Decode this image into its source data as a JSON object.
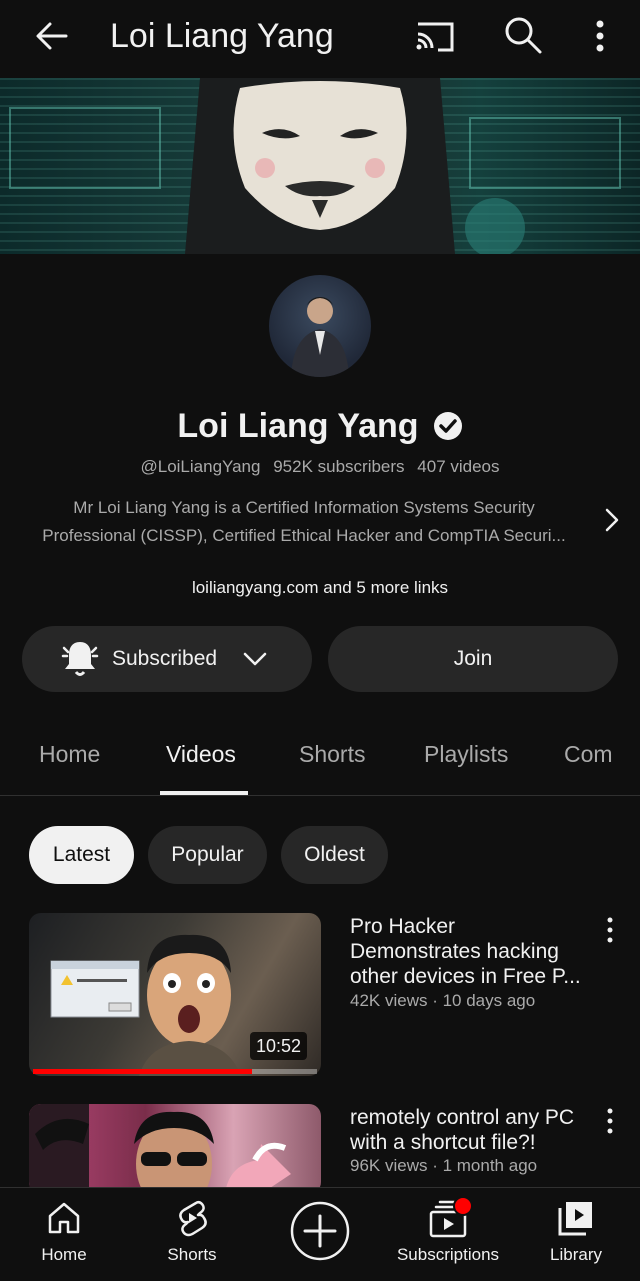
{
  "header": {
    "title": "Loi Liang Yang"
  },
  "channel": {
    "name": "Loi Liang Yang",
    "handle": "@LoiLiangYang",
    "subscribers": "952K subscribers",
    "videos": "407 videos",
    "description_line1": "Mr Loi Liang Yang is a Certified Information Systems Security",
    "description_line2": "Professional (CISSP), Certified Ethical Hacker and CompTIA Securi...",
    "links": "loiliangyang.com and 5 more links"
  },
  "actions": {
    "subscribed_label": "Subscribed",
    "join_label": "Join"
  },
  "tabs": [
    {
      "label": "Home"
    },
    {
      "label": "Videos"
    },
    {
      "label": "Shorts"
    },
    {
      "label": "Playlists"
    },
    {
      "label": "Com"
    }
  ],
  "active_tab": "Videos",
  "chips": [
    {
      "label": "Latest"
    },
    {
      "label": "Popular"
    },
    {
      "label": "Oldest"
    }
  ],
  "active_chip": "Latest",
  "videos": [
    {
      "title_line1": "Pro Hacker",
      "title_line2": "Demonstrates hacking",
      "title_line3": "other devices in Free P...",
      "meta": "42K views · 10 days ago",
      "duration": "10:52",
      "watched_fraction": 0.77
    },
    {
      "title_line1": "remotely control any PC",
      "title_line2": "with a shortcut file?!",
      "meta": "96K views · 1 month ago"
    }
  ],
  "bottom_nav": [
    {
      "label": "Home",
      "icon": "home-icon"
    },
    {
      "label": "Shorts",
      "icon": "shorts-icon"
    },
    {
      "label": "",
      "icon": "create-icon"
    },
    {
      "label": "Subscriptions",
      "icon": "subscriptions-icon"
    },
    {
      "label": "Library",
      "icon": "library-icon"
    }
  ],
  "colors": {
    "background": "#0f0f0f",
    "surface": "#272727",
    "text": "#f1f1f1",
    "muted": "#aaaaaa",
    "accent": "#ff0000"
  }
}
